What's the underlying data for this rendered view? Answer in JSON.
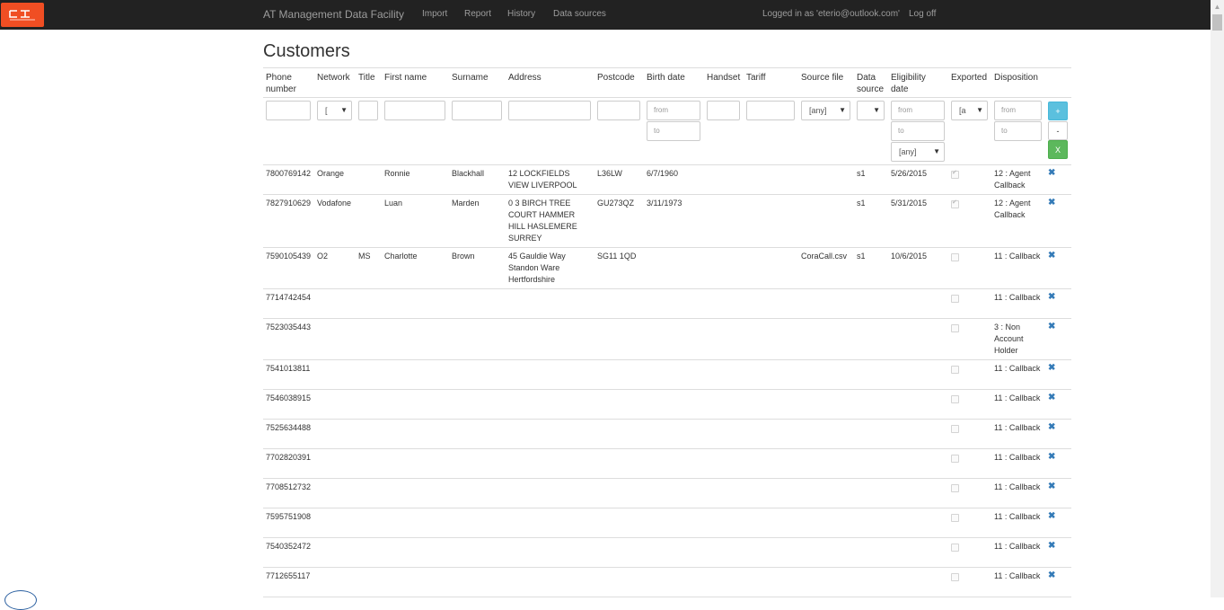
{
  "navbar": {
    "brand": "AT Management Data Facility",
    "links": [
      "Import",
      "Report",
      "History",
      "Data sources"
    ],
    "logged_in": "Logged in as 'eterio@outlook.com'",
    "logoff": "Log off",
    "logo_color": "#f04e23"
  },
  "page": {
    "title": "Customers"
  },
  "columns": {
    "phone": "Phone number",
    "network": "Network",
    "title": "Title",
    "first_name": "First name",
    "surname": "Surname",
    "address": "Address",
    "postcode": "Postcode",
    "birth_date": "Birth date",
    "handset": "Handset",
    "tariff": "Tariff",
    "source_file": "Source file",
    "data_source": "Data source",
    "eligibility_date": "Eligibility date",
    "exported": "Exported",
    "disposition": "Disposition"
  },
  "filters": {
    "network_value": "[",
    "birth_from": "from",
    "birth_to": "to",
    "source_file_value": "[any]",
    "elig_from": "from",
    "elig_to": "to",
    "elig_any": "[any]",
    "exported_value": "[a",
    "disp_from": "from",
    "disp_to": "to",
    "plus_label": "+",
    "minus_label": "-",
    "clear_label": "X"
  },
  "rows": [
    {
      "phone": "7800769142",
      "network": "Orange",
      "title": "",
      "first_name": "Ronnie",
      "surname": "Blackhall",
      "address": "12 LOCKFIELDS VIEW LIVERPOOL",
      "postcode": "L36LW",
      "birth_date": "6/7/1960",
      "source_file": "",
      "data_source": "s1",
      "eligibility_date": "5/26/2015",
      "exported": true,
      "disposition": "12 : Agent Callback"
    },
    {
      "phone": "7827910629",
      "network": "Vodafone",
      "title": "",
      "first_name": "Luan",
      "surname": "Marden",
      "address": "0 3 BIRCH TREE COURT HAMMER HILL HASLEMERE SURREY",
      "postcode": "GU273QZ",
      "birth_date": "3/11/1973",
      "source_file": "",
      "data_source": "s1",
      "eligibility_date": "5/31/2015",
      "exported": true,
      "disposition": "12 : Agent Callback"
    },
    {
      "phone": "7590105439",
      "network": "O2",
      "title": "MS",
      "first_name": "Charlotte",
      "surname": "Brown",
      "address": "45 Gauldie Way Standon Ware Hertfordshire",
      "postcode": "SG11 1QD",
      "birth_date": "",
      "source_file": "CoraCall.csv",
      "data_source": "s1",
      "eligibility_date": "10/6/2015",
      "exported": false,
      "disposition": "11 : Callback"
    },
    {
      "phone": "7714742454",
      "network": "",
      "title": "",
      "first_name": "",
      "surname": "",
      "address": "",
      "postcode": "",
      "birth_date": "",
      "source_file": "",
      "data_source": "",
      "eligibility_date": "",
      "exported": false,
      "disposition": "11 : Callback"
    },
    {
      "phone": "7523035443",
      "network": "",
      "title": "",
      "first_name": "",
      "surname": "",
      "address": "",
      "postcode": "",
      "birth_date": "",
      "source_file": "",
      "data_source": "",
      "eligibility_date": "",
      "exported": false,
      "disposition": "3 : Non Account Holder"
    },
    {
      "phone": "7541013811",
      "network": "",
      "title": "",
      "first_name": "",
      "surname": "",
      "address": "",
      "postcode": "",
      "birth_date": "",
      "source_file": "",
      "data_source": "",
      "eligibility_date": "",
      "exported": false,
      "disposition": "11 : Callback"
    },
    {
      "phone": "7546038915",
      "network": "",
      "title": "",
      "first_name": "",
      "surname": "",
      "address": "",
      "postcode": "",
      "birth_date": "",
      "source_file": "",
      "data_source": "",
      "eligibility_date": "",
      "exported": false,
      "disposition": "11 : Callback"
    },
    {
      "phone": "7525634488",
      "network": "",
      "title": "",
      "first_name": "",
      "surname": "",
      "address": "",
      "postcode": "",
      "birth_date": "",
      "source_file": "",
      "data_source": "",
      "eligibility_date": "",
      "exported": false,
      "disposition": "11 : Callback"
    },
    {
      "phone": "7702820391",
      "network": "",
      "title": "",
      "first_name": "",
      "surname": "",
      "address": "",
      "postcode": "",
      "birth_date": "",
      "source_file": "",
      "data_source": "",
      "eligibility_date": "",
      "exported": false,
      "disposition": "11 : Callback"
    },
    {
      "phone": "7708512732",
      "network": "",
      "title": "",
      "first_name": "",
      "surname": "",
      "address": "",
      "postcode": "",
      "birth_date": "",
      "source_file": "",
      "data_source": "",
      "eligibility_date": "",
      "exported": false,
      "disposition": "11 : Callback"
    },
    {
      "phone": "7595751908",
      "network": "",
      "title": "",
      "first_name": "",
      "surname": "",
      "address": "",
      "postcode": "",
      "birth_date": "",
      "source_file": "",
      "data_source": "",
      "eligibility_date": "",
      "exported": false,
      "disposition": "11 : Callback"
    },
    {
      "phone": "7540352472",
      "network": "",
      "title": "",
      "first_name": "",
      "surname": "",
      "address": "",
      "postcode": "",
      "birth_date": "",
      "source_file": "",
      "data_source": "",
      "eligibility_date": "",
      "exported": false,
      "disposition": "11 : Callback"
    },
    {
      "phone": "7712655117",
      "network": "",
      "title": "",
      "first_name": "",
      "surname": "",
      "address": "",
      "postcode": "",
      "birth_date": "",
      "source_file": "",
      "data_source": "",
      "eligibility_date": "",
      "exported": false,
      "disposition": "11 : Callback"
    }
  ],
  "icons": {
    "delete": "remove-icon",
    "logo": "brand-logo-icon"
  }
}
